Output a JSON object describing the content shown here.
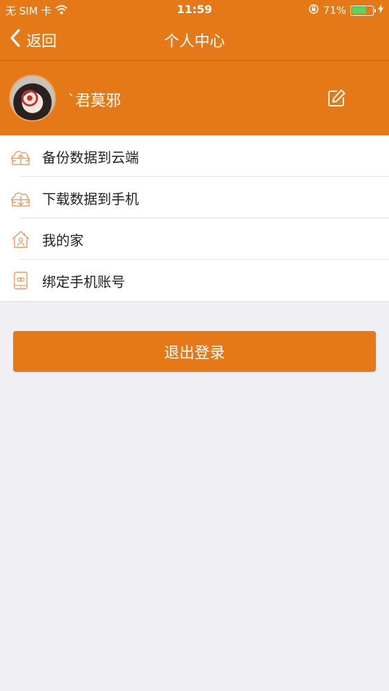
{
  "status_bar": {
    "carrier": "无 SIM 卡",
    "time": "11:59",
    "battery_percent": "71%",
    "battery_level": 0.71
  },
  "nav": {
    "back_label": "返回",
    "title": "个人中心"
  },
  "profile": {
    "username": "`君莫邪"
  },
  "menu": {
    "items": [
      {
        "label": "备份数据到云端",
        "icon": "cloud-upload-icon"
      },
      {
        "label": "下载数据到手机",
        "icon": "cloud-download-icon"
      },
      {
        "label": "我的家",
        "icon": "home-icon"
      },
      {
        "label": "绑定手机账号",
        "icon": "phone-link-icon"
      }
    ]
  },
  "logout": {
    "label": "退出登录"
  },
  "colors": {
    "accent": "#e57917",
    "background": "#efeff4",
    "battery_fill": "#4cd964"
  }
}
